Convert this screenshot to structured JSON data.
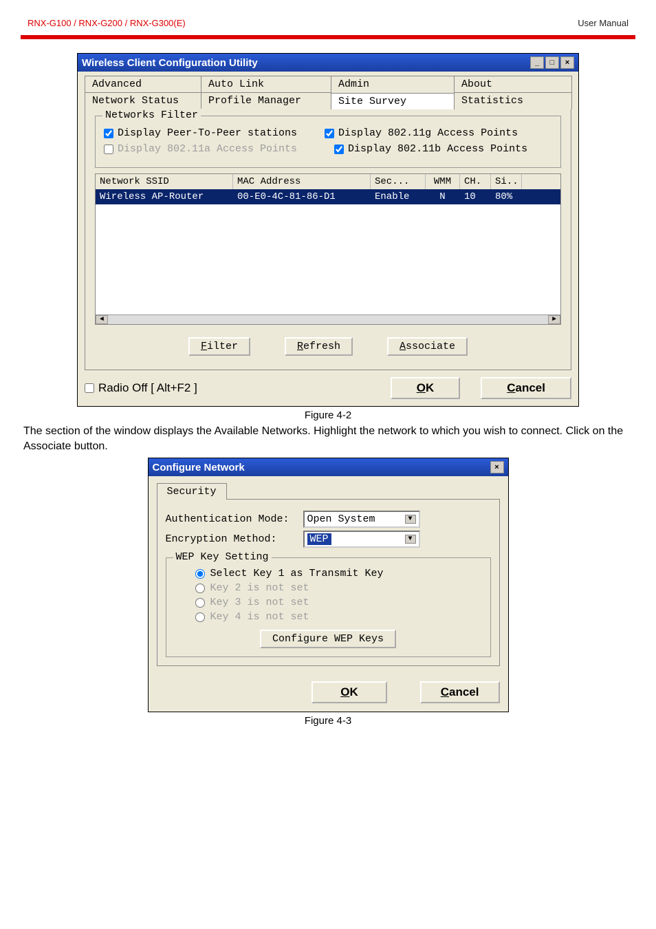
{
  "header": {
    "left": "RNX-G100  /  RNX-G200  /  RNX-G300(E)",
    "right": "User  Manual"
  },
  "win1": {
    "title": "Wireless Client Configuration Utility",
    "tabs_row1": [
      "Advanced",
      "Auto Link",
      "Admin",
      "About"
    ],
    "tabs_row2": [
      "Network Status",
      "Profile Manager",
      "Site Survey",
      "Statistics"
    ],
    "filter_legend": "Networks Filter",
    "chk_p2p": "Display Peer-To-Peer stations",
    "chk_11g": "Display 802.11g Access Points",
    "chk_11a": "Display 802.11a Access Points",
    "chk_11b": "Display 802.11b Access Points",
    "th_ssid": "Network SSID",
    "th_mac": "MAC Address",
    "th_sec": "Sec...",
    "th_wmm": "WMM",
    "th_ch": "CH.",
    "th_si": "Si..",
    "row": {
      "ssid": "Wireless AP-Router",
      "mac": "00-E0-4C-81-86-D1",
      "sec": "Enable",
      "wmm": "N",
      "ch": "10",
      "si": "80%"
    },
    "btn_filter": "Filter",
    "btn_refresh": "Refresh",
    "btn_assoc": "Associate",
    "radio_off": "Radio Off  [ Alt+F2 ]",
    "btn_ok": "OK",
    "btn_cancel": "Cancel"
  },
  "caption1": "Figure 4-2",
  "paragraph": "The section of the window displays the Available Networks. Highlight the network to which you wish to connect. Click on the Associate button.",
  "win2": {
    "title": "Configure Network",
    "tab": "Security",
    "label_auth": "Authentication Mode:",
    "val_auth": "Open System",
    "label_enc": "Encryption Method:",
    "val_enc": "WEP",
    "group_legend": "WEP Key Setting",
    "radios": [
      "Select Key 1 as Transmit Key",
      "Key 2 is not set",
      "Key 3 is not set",
      "Key 4 is not set"
    ],
    "btn_cfg": "Configure WEP Keys",
    "btn_ok": "OK",
    "btn_cancel": "Cancel"
  },
  "caption2": "Figure 4-3"
}
